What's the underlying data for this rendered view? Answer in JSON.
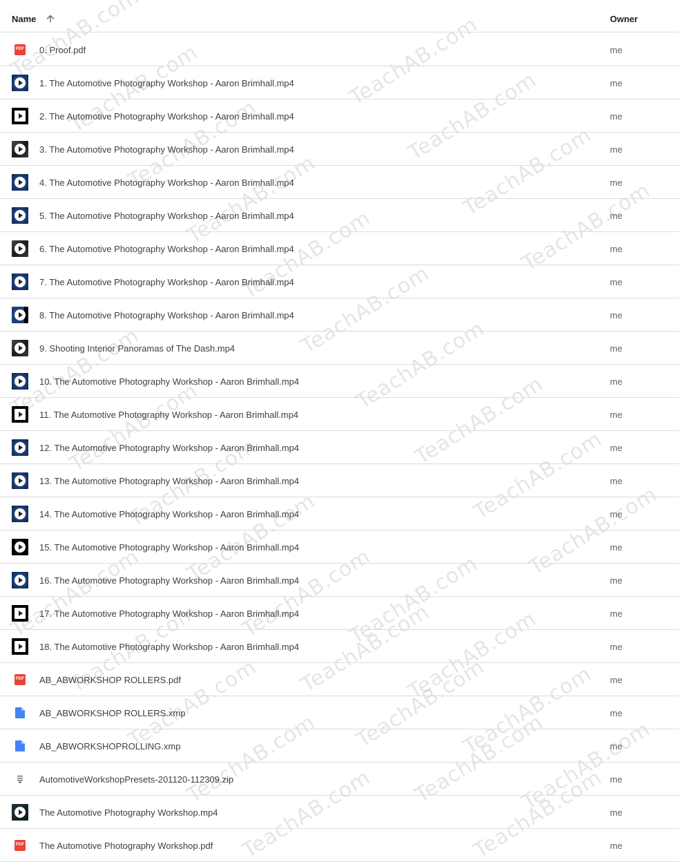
{
  "header": {
    "name_label": "Name",
    "owner_label": "Owner",
    "sort_icon": "arrow-upward-icon"
  },
  "files": [
    {
      "name": "0. Proof.pdf",
      "owner": "me",
      "type": "pdf"
    },
    {
      "name": "1. The Automotive Photography Workshop - Aaron Brimhall.mp4",
      "owner": "me",
      "type": "video",
      "thumb": "blue"
    },
    {
      "name": "2. The Automotive Photography Workshop - Aaron Brimhall.mp4",
      "owner": "me",
      "type": "video",
      "thumb": "black"
    },
    {
      "name": "3. The Automotive Photography Workshop - Aaron Brimhall.mp4",
      "owner": "me",
      "type": "video",
      "thumb": "dark"
    },
    {
      "name": "4. The Automotive Photography Workshop - Aaron Brimhall.mp4",
      "owner": "me",
      "type": "video",
      "thumb": "blue"
    },
    {
      "name": "5. The Automotive Photography Workshop - Aaron Brimhall.mp4",
      "owner": "me",
      "type": "video",
      "thumb": "blue"
    },
    {
      "name": "6. The Automotive Photography Workshop - Aaron Brimhall.mp4",
      "owner": "me",
      "type": "video",
      "thumb": "dark"
    },
    {
      "name": "7. The Automotive Photography Workshop - Aaron Brimhall.mp4",
      "owner": "me",
      "type": "video",
      "thumb": "blue"
    },
    {
      "name": "8. The Automotive Photography Workshop - Aaron Brimhall.mp4",
      "owner": "me",
      "type": "video",
      "thumb": "blue-edge"
    },
    {
      "name": "9. Shooting Interior Panoramas of The Dash.mp4",
      "owner": "me",
      "type": "video",
      "thumb": "dark"
    },
    {
      "name": "10. The Automotive Photography Workshop - Aaron Brimhall.mp4",
      "owner": "me",
      "type": "video",
      "thumb": "blue"
    },
    {
      "name": "11. The Automotive Photography Workshop - Aaron Brimhall.mp4",
      "owner": "me",
      "type": "video",
      "thumb": "black"
    },
    {
      "name": "12. The Automotive Photography Workshop - Aaron Brimhall.mp4",
      "owner": "me",
      "type": "video",
      "thumb": "blue"
    },
    {
      "name": "13. The Automotive Photography Workshop - Aaron Brimhall.mp4",
      "owner": "me",
      "type": "video",
      "thumb": "blue"
    },
    {
      "name": "14. The Automotive Photography Workshop - Aaron Brimhall.mp4",
      "owner": "me",
      "type": "video",
      "thumb": "blue"
    },
    {
      "name": "15. The Automotive Photography Workshop - Aaron Brimhall.mp4",
      "owner": "me",
      "type": "video",
      "thumb": "black-left"
    },
    {
      "name": "16. The Automotive Photography Workshop - Aaron Brimhall.mp4",
      "owner": "me",
      "type": "video",
      "thumb": "blue"
    },
    {
      "name": "17. The Automotive Photography Workshop - Aaron Brimhall.mp4",
      "owner": "me",
      "type": "video",
      "thumb": "black"
    },
    {
      "name": "18. The Automotive Photography Workshop - Aaron Brimhall.mp4",
      "owner": "me",
      "type": "video",
      "thumb": "black"
    },
    {
      "name": "AB_ABWORKSHOP ROLLERS.pdf",
      "owner": "me",
      "type": "pdf"
    },
    {
      "name": "AB_ABWORKSHOP ROLLERS.xmp",
      "owner": "me",
      "type": "doc"
    },
    {
      "name": "AB_ABWORKSHOPROLLING.xmp",
      "owner": "me",
      "type": "doc"
    },
    {
      "name": "AutomotiveWorkshopPresets-201120-112309.zip",
      "owner": "me",
      "type": "zip"
    },
    {
      "name": "The Automotive Photography Workshop.mp4",
      "owner": "me",
      "type": "video",
      "thumb": "teal"
    },
    {
      "name": "The Automotive Photography Workshop.pdf",
      "owner": "me",
      "type": "pdf"
    }
  ],
  "pdf_badge": "PDF",
  "watermark_text": "TeachAB.com",
  "colors": {
    "pdf_red": "#ea4335",
    "doc_blue": "#4285f4",
    "divider": "#dadce0"
  }
}
